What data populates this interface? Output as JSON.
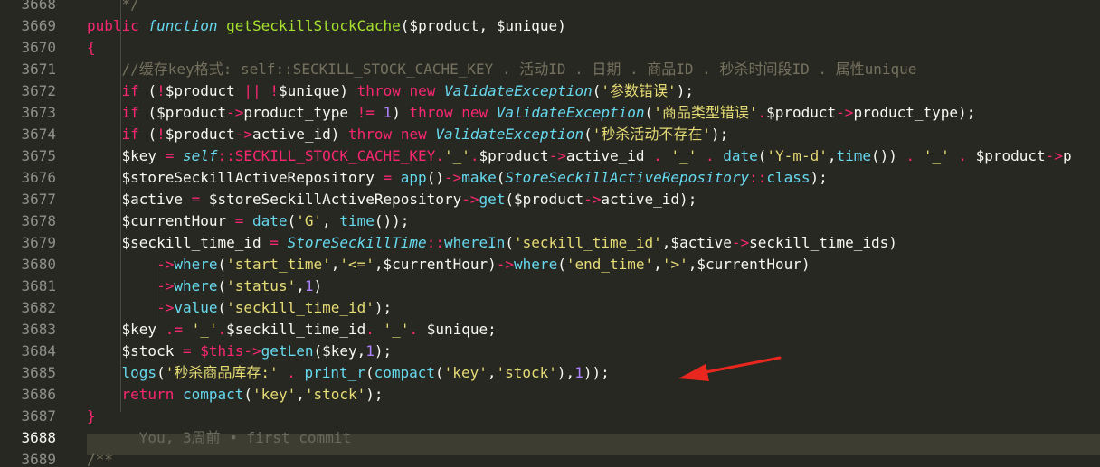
{
  "editor": {
    "current_line": "3688",
    "line_numbers": [
      "3668",
      "3669",
      "3670",
      "3671",
      "3672",
      "3673",
      "3674",
      "3675",
      "3676",
      "3677",
      "3678",
      "3679",
      "3680",
      "3681",
      "3682",
      "3683",
      "3684",
      "3685",
      "3686",
      "3687",
      "3688",
      "3689"
    ],
    "lines": [
      [
        {
          "t": "    */",
          "c": "c"
        }
      ],
      [
        {
          "t": "public ",
          "c": "k"
        },
        {
          "t": "function ",
          "c": "i"
        },
        {
          "t": "getSeckillStockCache",
          "c": "g"
        },
        {
          "t": "($product, $unique)",
          "c": "v"
        }
      ],
      [
        {
          "t": "{",
          "c": "k"
        }
      ],
      [
        {
          "t": "    //缓存key格式: self::SECKILL_STOCK_CACHE_KEY . 活动ID . 日期 . 商品ID . 秒杀时间段ID . 属性unique",
          "c": "c"
        }
      ],
      [
        {
          "t": "    if ",
          "c": "k"
        },
        {
          "t": "(",
          "c": "v"
        },
        {
          "t": "!",
          "c": "k"
        },
        {
          "t": "$product ",
          "c": "v"
        },
        {
          "t": "|| ",
          "c": "k"
        },
        {
          "t": "!",
          "c": "k"
        },
        {
          "t": "$unique) ",
          "c": "v"
        },
        {
          "t": "throw new ",
          "c": "k"
        },
        {
          "t": "ValidateException",
          "c": "i"
        },
        {
          "t": "(",
          "c": "v"
        },
        {
          "t": "'参数错误'",
          "c": "s"
        },
        {
          "t": ");",
          "c": "v"
        }
      ],
      [
        {
          "t": "    if ",
          "c": "k"
        },
        {
          "t": "($product",
          "c": "v"
        },
        {
          "t": "->",
          "c": "k"
        },
        {
          "t": "product_type ",
          "c": "v"
        },
        {
          "t": "!= ",
          "c": "k"
        },
        {
          "t": "1",
          "c": "n"
        },
        {
          "t": ") ",
          "c": "v"
        },
        {
          "t": "throw new ",
          "c": "k"
        },
        {
          "t": "ValidateException",
          "c": "i"
        },
        {
          "t": "(",
          "c": "v"
        },
        {
          "t": "'商品类型错误'",
          "c": "s"
        },
        {
          "t": ".",
          "c": "k"
        },
        {
          "t": "$product",
          "c": "v"
        },
        {
          "t": "->",
          "c": "k"
        },
        {
          "t": "product_type);",
          "c": "v"
        }
      ],
      [
        {
          "t": "    if ",
          "c": "k"
        },
        {
          "t": "(",
          "c": "v"
        },
        {
          "t": "!",
          "c": "k"
        },
        {
          "t": "$product",
          "c": "v"
        },
        {
          "t": "->",
          "c": "k"
        },
        {
          "t": "active_id) ",
          "c": "v"
        },
        {
          "t": "throw new ",
          "c": "k"
        },
        {
          "t": "ValidateException",
          "c": "i"
        },
        {
          "t": "(",
          "c": "v"
        },
        {
          "t": "'秒杀活动不存在'",
          "c": "s"
        },
        {
          "t": ");",
          "c": "v"
        }
      ],
      [
        {
          "t": "    $key ",
          "c": "v"
        },
        {
          "t": "= ",
          "c": "k"
        },
        {
          "t": "self",
          "c": "i"
        },
        {
          "t": "::",
          "c": "k"
        },
        {
          "t": "SECKILL_STOCK_CACHE_KEY",
          "c": "k"
        },
        {
          "t": ".",
          "c": "k"
        },
        {
          "t": "'_'",
          "c": "s"
        },
        {
          "t": ".",
          "c": "k"
        },
        {
          "t": "$product",
          "c": "v"
        },
        {
          "t": "->",
          "c": "k"
        },
        {
          "t": "active_id ",
          "c": "v"
        },
        {
          "t": ". ",
          "c": "k"
        },
        {
          "t": "'_' ",
          "c": "s"
        },
        {
          "t": ". ",
          "c": "k"
        },
        {
          "t": "date",
          "c": "f"
        },
        {
          "t": "(",
          "c": "v"
        },
        {
          "t": "'Y-m-d'",
          "c": "s"
        },
        {
          "t": ",",
          "c": "v"
        },
        {
          "t": "time",
          "c": "f"
        },
        {
          "t": "()) ",
          "c": "v"
        },
        {
          "t": ". ",
          "c": "k"
        },
        {
          "t": "'_' ",
          "c": "s"
        },
        {
          "t": ". ",
          "c": "k"
        },
        {
          "t": "$product",
          "c": "v"
        },
        {
          "t": "->",
          "c": "k"
        },
        {
          "t": "p",
          "c": "v"
        }
      ],
      [
        {
          "t": "    $storeSeckillActiveRepository ",
          "c": "v"
        },
        {
          "t": "= ",
          "c": "k"
        },
        {
          "t": "app",
          "c": "f"
        },
        {
          "t": "()",
          "c": "v"
        },
        {
          "t": "->",
          "c": "k"
        },
        {
          "t": "make",
          "c": "f"
        },
        {
          "t": "(",
          "c": "v"
        },
        {
          "t": "StoreSeckillActiveRepository",
          "c": "i"
        },
        {
          "t": "::",
          "c": "k"
        },
        {
          "t": "class",
          "c": "f"
        },
        {
          "t": ");",
          "c": "v"
        }
      ],
      [
        {
          "t": "    $active ",
          "c": "v"
        },
        {
          "t": "= ",
          "c": "k"
        },
        {
          "t": "$storeSeckillActiveRepository",
          "c": "v"
        },
        {
          "t": "->",
          "c": "k"
        },
        {
          "t": "get",
          "c": "f"
        },
        {
          "t": "($product",
          "c": "v"
        },
        {
          "t": "->",
          "c": "k"
        },
        {
          "t": "active_id);",
          "c": "v"
        }
      ],
      [
        {
          "t": "    $currentHour ",
          "c": "v"
        },
        {
          "t": "= ",
          "c": "k"
        },
        {
          "t": "date",
          "c": "f"
        },
        {
          "t": "(",
          "c": "v"
        },
        {
          "t": "'G'",
          "c": "s"
        },
        {
          "t": ", ",
          "c": "v"
        },
        {
          "t": "time",
          "c": "f"
        },
        {
          "t": "());",
          "c": "v"
        }
      ],
      [
        {
          "t": "    $seckill_time_id ",
          "c": "v"
        },
        {
          "t": "= ",
          "c": "k"
        },
        {
          "t": "StoreSeckillTime",
          "c": "i"
        },
        {
          "t": "::",
          "c": "k"
        },
        {
          "t": "whereIn",
          "c": "f"
        },
        {
          "t": "(",
          "c": "v"
        },
        {
          "t": "'seckill_time_id'",
          "c": "s"
        },
        {
          "t": ",$active",
          "c": "v"
        },
        {
          "t": "->",
          "c": "k"
        },
        {
          "t": "seckill_time_ids)",
          "c": "v"
        }
      ],
      [
        {
          "t": "        ",
          "c": "v"
        },
        {
          "t": "->",
          "c": "k"
        },
        {
          "t": "where",
          "c": "f"
        },
        {
          "t": "(",
          "c": "v"
        },
        {
          "t": "'start_time'",
          "c": "s"
        },
        {
          "t": ",",
          "c": "v"
        },
        {
          "t": "'<='",
          "c": "s"
        },
        {
          "t": ",$currentHour)",
          "c": "v"
        },
        {
          "t": "->",
          "c": "k"
        },
        {
          "t": "where",
          "c": "f"
        },
        {
          "t": "(",
          "c": "v"
        },
        {
          "t": "'end_time'",
          "c": "s"
        },
        {
          "t": ",",
          "c": "v"
        },
        {
          "t": "'>'",
          "c": "s"
        },
        {
          "t": ",$currentHour)",
          "c": "v"
        }
      ],
      [
        {
          "t": "        ",
          "c": "v"
        },
        {
          "t": "->",
          "c": "k"
        },
        {
          "t": "where",
          "c": "f"
        },
        {
          "t": "(",
          "c": "v"
        },
        {
          "t": "'status'",
          "c": "s"
        },
        {
          "t": ",",
          "c": "v"
        },
        {
          "t": "1",
          "c": "n"
        },
        {
          "t": ")",
          "c": "v"
        }
      ],
      [
        {
          "t": "        ",
          "c": "v"
        },
        {
          "t": "->",
          "c": "k"
        },
        {
          "t": "value",
          "c": "f"
        },
        {
          "t": "(",
          "c": "v"
        },
        {
          "t": "'seckill_time_id'",
          "c": "s"
        },
        {
          "t": ");",
          "c": "v"
        }
      ],
      [
        {
          "t": "    $key ",
          "c": "v"
        },
        {
          "t": ".= ",
          "c": "k"
        },
        {
          "t": "'_'",
          "c": "s"
        },
        {
          "t": ".",
          "c": "k"
        },
        {
          "t": "$seckill_time_id",
          "c": "v"
        },
        {
          "t": ". ",
          "c": "k"
        },
        {
          "t": "'_'",
          "c": "s"
        },
        {
          "t": ". ",
          "c": "k"
        },
        {
          "t": "$unique;",
          "c": "v"
        }
      ],
      [
        {
          "t": "    $stock ",
          "c": "v"
        },
        {
          "t": "= ",
          "c": "k"
        },
        {
          "t": "$this",
          "c": "k"
        },
        {
          "t": "->",
          "c": "k"
        },
        {
          "t": "getLen",
          "c": "f"
        },
        {
          "t": "($key,",
          "c": "v"
        },
        {
          "t": "1",
          "c": "n"
        },
        {
          "t": ");",
          "c": "v"
        }
      ],
      [
        {
          "t": "    logs",
          "c": "f"
        },
        {
          "t": "(",
          "c": "v"
        },
        {
          "t": "'秒杀商品库存:' ",
          "c": "s"
        },
        {
          "t": ". ",
          "c": "k"
        },
        {
          "t": "print_r",
          "c": "f"
        },
        {
          "t": "(",
          "c": "v"
        },
        {
          "t": "compact",
          "c": "f"
        },
        {
          "t": "(",
          "c": "v"
        },
        {
          "t": "'key'",
          "c": "s"
        },
        {
          "t": ",",
          "c": "v"
        },
        {
          "t": "'stock'",
          "c": "s"
        },
        {
          "t": "),",
          "c": "v"
        },
        {
          "t": "1",
          "c": "n"
        },
        {
          "t": "));",
          "c": "v"
        }
      ],
      [
        {
          "t": "    return ",
          "c": "k"
        },
        {
          "t": "compact",
          "c": "f"
        },
        {
          "t": "(",
          "c": "v"
        },
        {
          "t": "'key'",
          "c": "s"
        },
        {
          "t": ",",
          "c": "v"
        },
        {
          "t": "'stock'",
          "c": "s"
        },
        {
          "t": ");",
          "c": "v"
        }
      ],
      [
        {
          "t": "}",
          "c": "k"
        }
      ],
      [
        {
          "t": "      You, 3周前 • first commit",
          "c": "blame"
        }
      ],
      [
        {
          "t": "/**",
          "c": "c"
        }
      ]
    ]
  },
  "colors": {
    "background": "#272822",
    "current_line": "#3e3d32",
    "arrow": "#e8271e"
  },
  "annotation": {
    "icon": "red-arrow-icon"
  }
}
